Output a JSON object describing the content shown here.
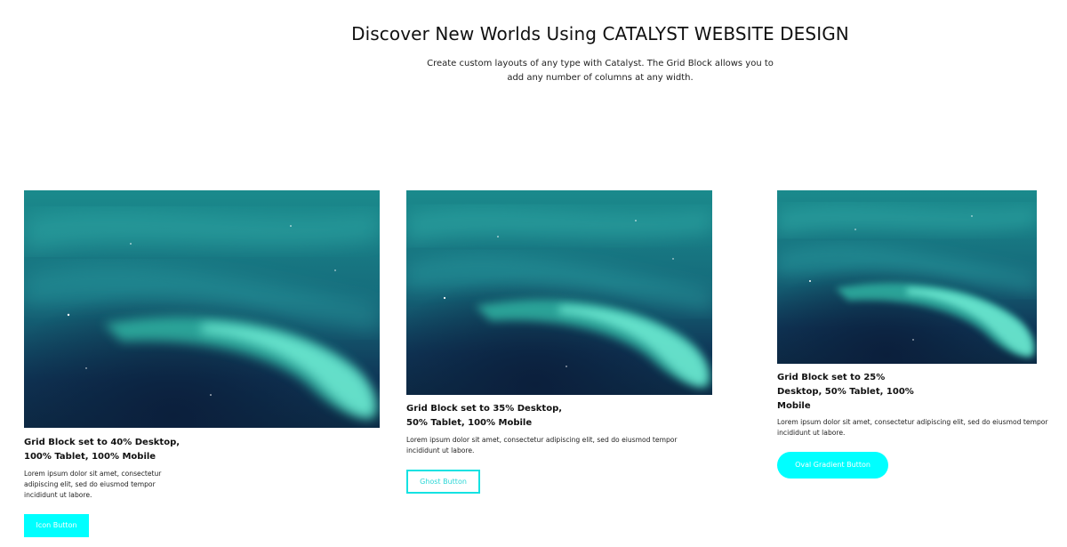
{
  "header": {
    "title": "Discover New Worlds Using CATALYST WEBSITE DESIGN",
    "subtitle": "Create custom layouts of any type with Catalyst. The Grid Block allows you to add any number of columns at any width."
  },
  "columns": [
    {
      "title": "Grid Block set to 40% Desktop, 100% Tablet, 100% Mobile",
      "body": "Lorem ipsum dolor sit amet, consectetur adipiscing elit, sed do eiusmod tempor incididunt ut labore.",
      "button_label": "Icon Button",
      "image": "aurora-image"
    },
    {
      "title": "Grid Block set to 35% Desktop, 50% Tablet, 100% Mobile",
      "body": "Lorem ipsum dolor sit amet, consectetur adipiscing elit, sed do eiusmod tempor incididunt ut labore.",
      "button_label": "Ghost Button",
      "image": "aurora-image"
    },
    {
      "title": "Grid Block set to 25% Desktop, 50% Tablet, 100% Mobile",
      "body": "Lorem ipsum dolor sit amet, consectetur adipiscing elit, sed do eiusmod tempor incididunt ut labore.",
      "button_label": "Oval Gradient Button",
      "image": "aurora-image"
    }
  ],
  "colors": {
    "accent": "#00ffff",
    "ghost_border": "#14e2e2",
    "sky_dark": "#0c2a44",
    "aurora": "#3ff0c8"
  }
}
